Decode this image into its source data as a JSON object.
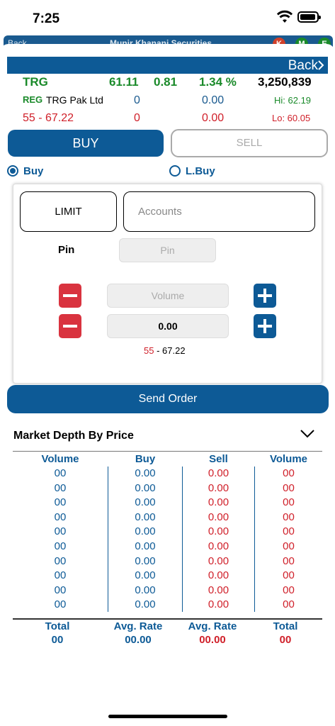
{
  "status_bar": {
    "time": "7:25"
  },
  "underlying_bar": {
    "back": "Back",
    "title": "Munir Khanani Securities"
  },
  "header": {
    "back_label": "Back"
  },
  "quote": {
    "symbol": "TRG",
    "last": "61.11",
    "change": "0.81",
    "change_pct": "1.34 %",
    "volume": "3,250,839",
    "market": "REG",
    "company": "TRG Pak Ltd",
    "bid_qty": "0",
    "bid_price": "0.00",
    "high": "Hi: 62.19",
    "range": "55 - 67.22",
    "ask_qty": "0",
    "ask_price": "0.00",
    "low": "Lo: 60.05"
  },
  "tabs": {
    "buy": "BUY",
    "sell": "SELL"
  },
  "order_type": {
    "buy": "Buy",
    "lbuy": "L.Buy",
    "selected": "Buy"
  },
  "order_form": {
    "limit_label": "LIMIT",
    "accounts_placeholder": "Accounts",
    "pin_label": "Pin",
    "pin_placeholder": "Pin",
    "volume_placeholder": "Volume",
    "price_value": "0.00",
    "price_range_low": "55",
    "price_range_sep": " - ",
    "price_range_high": "67.22"
  },
  "send_order": "Send Order",
  "market_depth": {
    "title": "Market Depth By Price",
    "columns": [
      "Volume",
      "Buy",
      "Sell",
      "Volume"
    ],
    "rows": [
      [
        "00",
        "0.00",
        "0.00",
        "00"
      ],
      [
        "00",
        "0.00",
        "0.00",
        "00"
      ],
      [
        "00",
        "0.00",
        "0.00",
        "00"
      ],
      [
        "00",
        "0.00",
        "0.00",
        "00"
      ],
      [
        "00",
        "0.00",
        "0.00",
        "00"
      ],
      [
        "00",
        "0.00",
        "0.00",
        "00"
      ],
      [
        "00",
        "0.00",
        "0.00",
        "00"
      ],
      [
        "00",
        "0.00",
        "0.00",
        "00"
      ],
      [
        "00",
        "0.00",
        "0.00",
        "00"
      ],
      [
        "00",
        "0.00",
        "0.00",
        "00"
      ]
    ],
    "footer_labels": [
      "Total",
      "Avg. Rate",
      "Avg. Rate",
      "Total"
    ],
    "footer_values": [
      "00",
      "00.00",
      "00.00",
      "00"
    ]
  },
  "colors": {
    "brand_blue": "#0d5a96",
    "green": "#1a8a2a",
    "red": "#d0202a"
  },
  "icons": [
    "wifi-icon",
    "battery-icon",
    "back-chevron-icon",
    "radio-icon",
    "minus-icon",
    "plus-icon",
    "chevron-down-icon"
  ]
}
